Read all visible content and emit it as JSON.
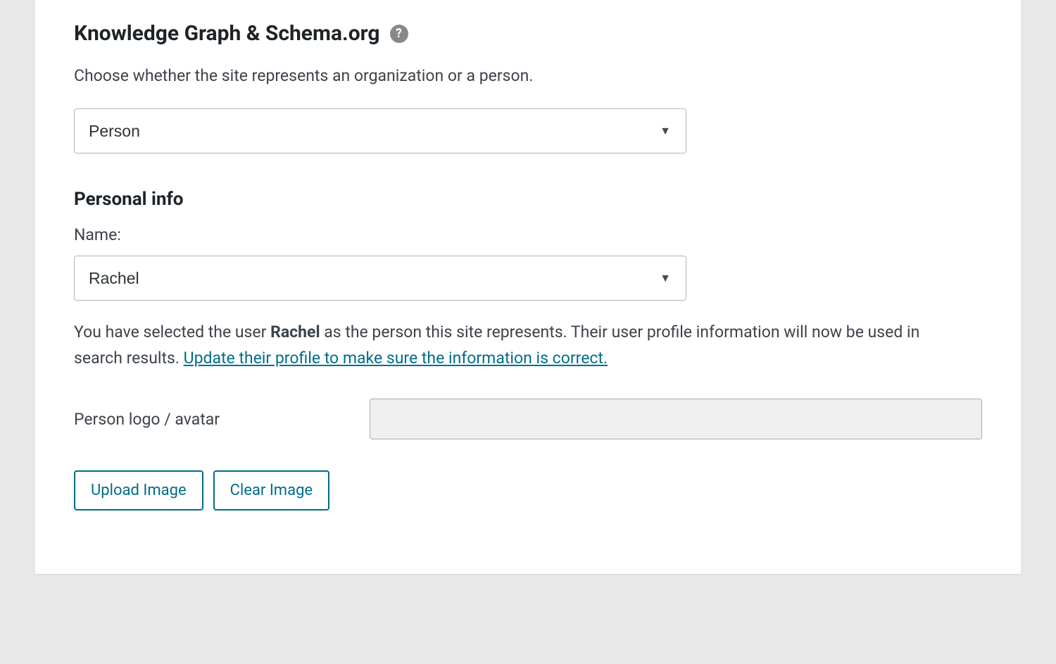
{
  "section": {
    "heading": "Knowledge Graph & Schema.org",
    "help_tooltip": "?",
    "description": "Choose whether the site represents an organization or a person."
  },
  "entity_type_select": {
    "value": "Person"
  },
  "personal_info": {
    "heading": "Personal info",
    "name_label": "Name:",
    "name_select_value": "Rachel",
    "info_pre": "You have selected the user ",
    "info_user": "Rachel",
    "info_post": " as the person this site represents. Their user profile information will now be used in search results. ",
    "info_link": "Update their profile to make sure the information is correct."
  },
  "logo": {
    "label": "Person logo / avatar",
    "input_value": ""
  },
  "buttons": {
    "upload": "Upload Image",
    "clear": "Clear Image"
  }
}
